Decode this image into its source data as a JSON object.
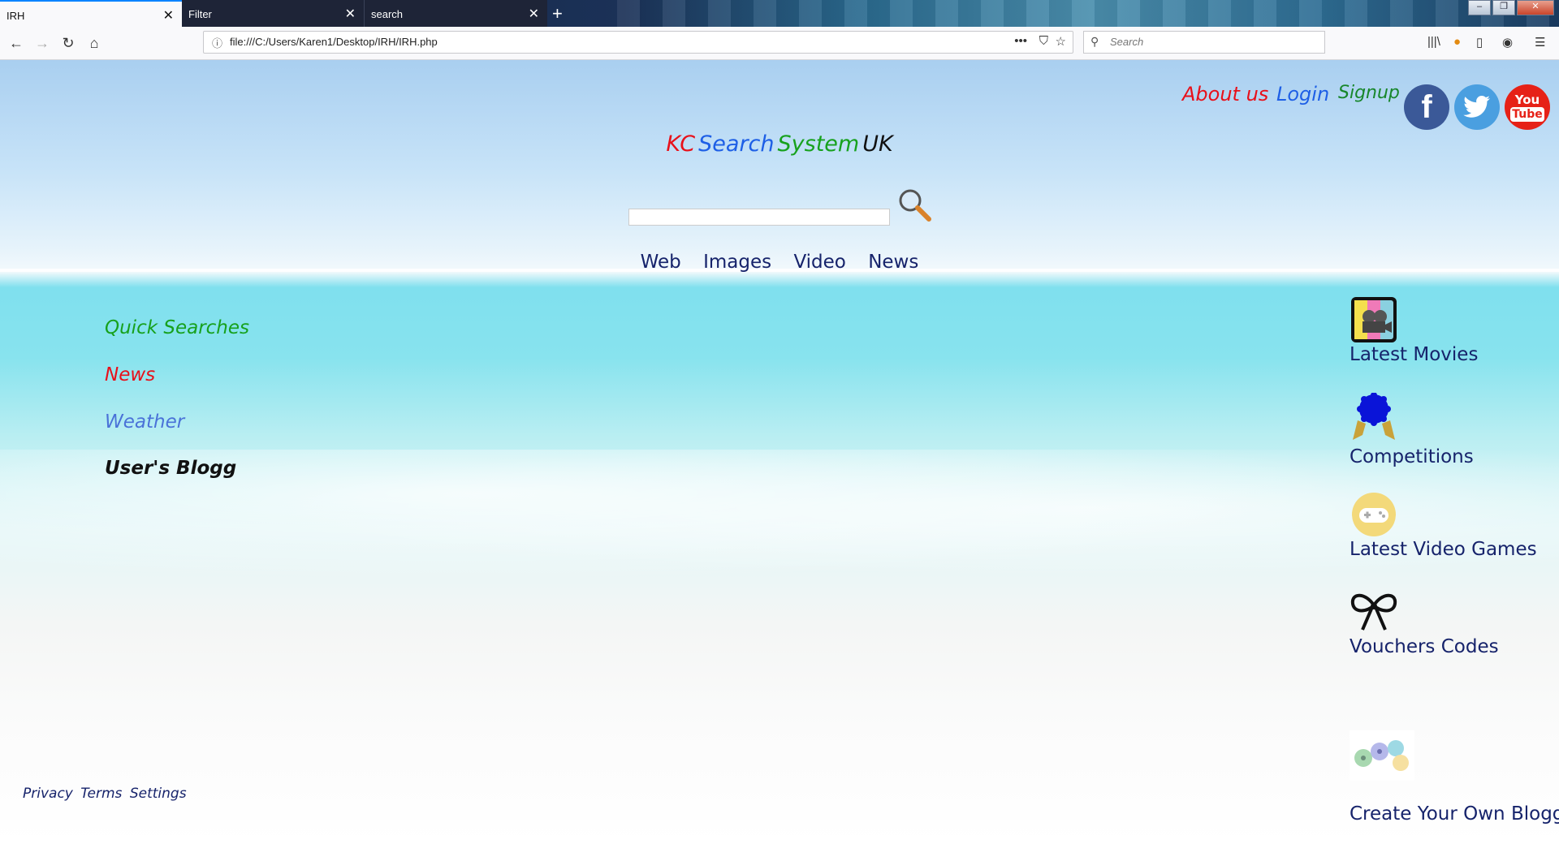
{
  "browser": {
    "tabs": [
      {
        "label": "IRH"
      },
      {
        "label": "Filter"
      },
      {
        "label": "search"
      }
    ],
    "url": "file:///C:/Users/Karen1/Desktop/IRH/IRH.php",
    "search_placeholder": "Search"
  },
  "page": {
    "top_links": {
      "about": "About us",
      "login": "Login",
      "signup": "Signup"
    },
    "social": {
      "youtube_line1": "You",
      "youtube_line2": "Tube"
    },
    "brand": {
      "part1": "KC",
      "part2": "Search",
      "part3": "System",
      "part4": "UK"
    },
    "search_tabs": [
      "Web",
      "Images",
      "Video",
      "News"
    ],
    "sidebar": [
      "Quick Searches",
      "News",
      "Weather",
      "User's Blogg"
    ],
    "right_links": [
      "Latest Movies",
      "Competitions",
      "Latest Video Games",
      "Vouchers Codes",
      "Create Your Own Blogg!"
    ],
    "footer": [
      "Privacy",
      "Terms",
      "Settings"
    ],
    "colors": {
      "red": "#e8101a",
      "blue": "#1e5fe6",
      "green": "#17a11d",
      "navy": "#16236b",
      "facebook": "#3b5998",
      "twitter": "#1da1f2",
      "youtube": "#e62117"
    }
  }
}
